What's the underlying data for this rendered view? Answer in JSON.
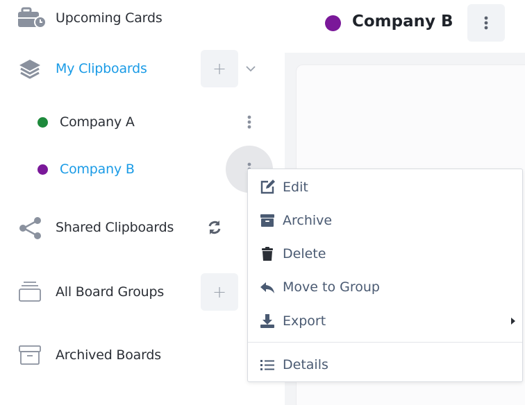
{
  "sidebar": {
    "upcoming_cards": "Upcoming Cards",
    "my_clipboards": "My Clipboards",
    "add_symbol": "+",
    "boards": [
      {
        "label": "Company A",
        "dot_color": "#1e8a3c"
      },
      {
        "label": "Company B",
        "dot_color": "#7a1899"
      }
    ],
    "shared_clipboards": "Shared Clipboards",
    "all_board_groups": "All Board Groups",
    "archived_boards": "Archived Boards"
  },
  "header": {
    "title": "Company B",
    "dot_color": "#7a1899"
  },
  "context_menu": {
    "items": [
      {
        "label": "Edit",
        "icon": "edit-icon"
      },
      {
        "label": "Archive",
        "icon": "archive-box-icon"
      },
      {
        "label": "Delete",
        "icon": "trash-icon"
      },
      {
        "label": "Move to Group",
        "icon": "reply-arrow-icon"
      },
      {
        "label": "Export",
        "icon": "download-icon"
      },
      {
        "label": "Details",
        "icon": "list-icon"
      }
    ]
  },
  "colors": {
    "accent": "#1a9be6",
    "text": "#2b2f36",
    "menu_text": "#4a5a72",
    "icon_gray": "#7d8594"
  }
}
